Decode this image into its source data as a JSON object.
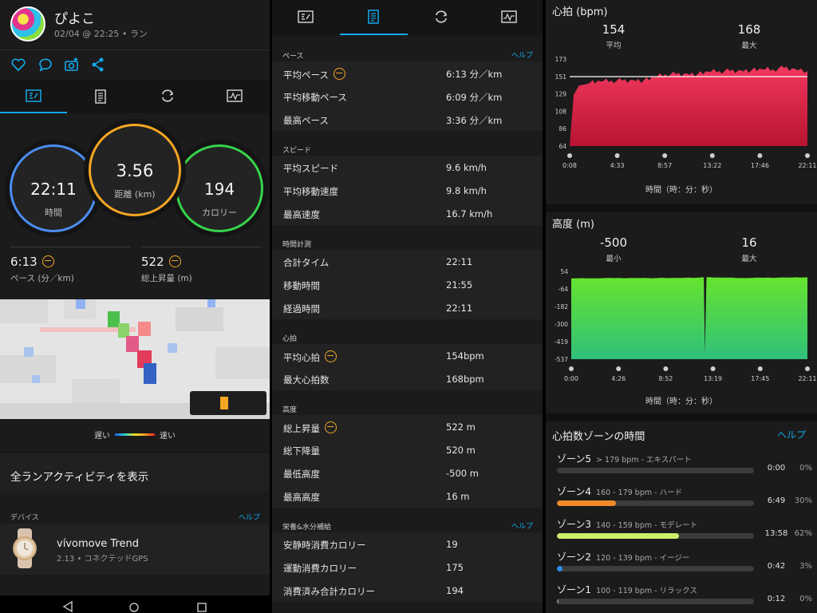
{
  "colors": {
    "accent": "#11a9ed",
    "hr_fill": "#e3274d",
    "elev_fill": "#5bd63c",
    "orange": "#f5a623"
  },
  "summary": {
    "user_name": "ぴよこ",
    "subtitle": "02/04 @ 22:25 • ラン",
    "time_value": "22:11",
    "time_label": "時間",
    "distance_value": "3.56",
    "distance_label": "距離 (km)",
    "calories_value": "194",
    "calories_label": "カロリー",
    "pace_value": "6:13",
    "pace_label": "ペース (分／km)",
    "ascent_value": "522",
    "ascent_label": "総上昇量 (m)",
    "legend_slow": "遅い",
    "legend_fast": "速い",
    "all_runs": "全ランアクティビティを表示",
    "device_section": "デバイス",
    "help": "ヘルプ",
    "device_name": "vívomove Trend",
    "device_sub": "2.13 • コネクテッドGPS"
  },
  "details": {
    "help": "ヘルプ",
    "sections": [
      {
        "title": "ペース",
        "help": true,
        "rows": [
          {
            "label": "平均ペース",
            "value": "6:13 分／km",
            "icon": true
          },
          {
            "label": "平均移動ペース",
            "value": "6:09 分／km"
          },
          {
            "label": "最高ペース",
            "value": "3:36 分／km"
          }
        ]
      },
      {
        "title": "スピード",
        "rows": [
          {
            "label": "平均スピード",
            "value": "9.6 km/h"
          },
          {
            "label": "平均移動速度",
            "value": "9.8 km/h"
          },
          {
            "label": "最高速度",
            "value": "16.7 km/h"
          }
        ]
      },
      {
        "title": "時間計測",
        "rows": [
          {
            "label": "合計タイム",
            "value": "22:11"
          },
          {
            "label": "移動時間",
            "value": "21:55"
          },
          {
            "label": "経過時間",
            "value": "22:11"
          }
        ]
      },
      {
        "title": "心拍",
        "rows": [
          {
            "label": "平均心拍",
            "value": "154bpm",
            "icon": true
          },
          {
            "label": "最大心拍数",
            "value": "168bpm"
          }
        ]
      },
      {
        "title": "高度",
        "rows": [
          {
            "label": "総上昇量",
            "value": "522 m",
            "icon": true
          },
          {
            "label": "総下降量",
            "value": "520 m"
          },
          {
            "label": "最低高度",
            "value": "-500 m"
          },
          {
            "label": "最高高度",
            "value": "16 m"
          }
        ]
      },
      {
        "title": "栄養&水分補給",
        "help": true,
        "rows": [
          {
            "label": "安静時消費カロリー",
            "value": "19"
          },
          {
            "label": "運動消費カロリー",
            "value": "175"
          },
          {
            "label": "消費済み合計カロリー",
            "value": "194"
          }
        ]
      }
    ]
  },
  "hr_chart": {
    "title": "心拍 (bpm)",
    "avg_value": "154",
    "avg_label": "平均",
    "max_value": "168",
    "max_label": "最大",
    "xunit": "時間（時：分：秒）"
  },
  "elev_chart": {
    "title": "高度 (m)",
    "min_value": "-500",
    "min_label": "最小",
    "max_value": "16",
    "max_label": "最大",
    "xunit": "時間（時：分：秒）"
  },
  "chart_data": [
    {
      "type": "area",
      "title": "心拍 (bpm)",
      "y_ticks": [
        "173",
        "151",
        "129",
        "108",
        "86",
        "64"
      ],
      "x_ticks": [
        "0:08",
        "4:33",
        "8:57",
        "13:22",
        "17:46",
        "22:11"
      ],
      "ylim": [
        64,
        173
      ],
      "reference_line": 151,
      "x_minutes": [
        0.13,
        0.5,
        1,
        1.5,
        2,
        3,
        4,
        5,
        6,
        7,
        8,
        9,
        10,
        11,
        12,
        13,
        14,
        15,
        16,
        17,
        18,
        19,
        20,
        21,
        22.18
      ],
      "values": [
        64,
        128,
        140,
        141,
        143,
        145,
        146,
        146,
        147,
        146,
        150,
        154,
        154,
        155,
        154,
        157,
        158,
        158,
        159,
        159,
        160,
        160,
        162,
        161,
        158
      ]
    },
    {
      "type": "area",
      "title": "高度 (m)",
      "y_ticks": [
        "54",
        "-64",
        "-182",
        "-300",
        "-419",
        "-537"
      ],
      "x_ticks": [
        "0:00",
        "4:26",
        "8:52",
        "13:19",
        "17:45",
        "22:11"
      ],
      "ylim": [
        -537,
        54
      ],
      "x_minutes": [
        0,
        2,
        4,
        6,
        8,
        10,
        12,
        12.45,
        12.55,
        12.7,
        14,
        16,
        18,
        20,
        22.18
      ],
      "values": [
        6,
        8,
        9,
        10,
        9,
        10,
        12,
        14,
        -500,
        14,
        12,
        10,
        11,
        13,
        14
      ]
    }
  ],
  "zones": {
    "title": "心拍数ゾーンの時間",
    "help": "ヘルプ",
    "items": [
      {
        "name": "ゾーン5",
        "sub": "> 179 bpm - エキスパート",
        "time": "0:00",
        "pct": "0%",
        "fraction": 0,
        "color": "#8a8a8a"
      },
      {
        "name": "ゾーン4",
        "sub": "160 - 179 bpm - ハード",
        "time": "6:49",
        "pct": "30%",
        "fraction": 0.3,
        "color": "#f0892a"
      },
      {
        "name": "ゾーン3",
        "sub": "140 - 159 bpm - モデレート",
        "time": "13:58",
        "pct": "62%",
        "fraction": 0.62,
        "color": "#c9ef6b"
      },
      {
        "name": "ゾーン2",
        "sub": "120 - 139 bpm - イージー",
        "time": "0:42",
        "pct": "3%",
        "fraction": 0.03,
        "color": "#2b8ef0"
      },
      {
        "name": "ゾーン1",
        "sub": "100 - 119 bpm - リラックス",
        "time": "0:12",
        "pct": "0%",
        "fraction": 0.01,
        "color": "#8a8a8a"
      }
    ]
  }
}
